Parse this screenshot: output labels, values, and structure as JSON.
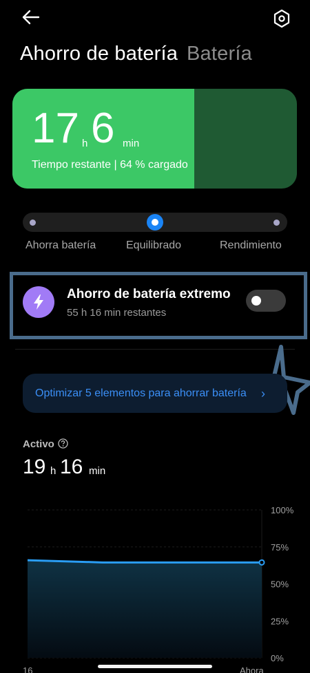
{
  "header": {
    "back_icon": "arrow-left-icon",
    "settings_icon": "gear-icon",
    "tabs": [
      {
        "label": "Ahorro de batería",
        "active": true
      },
      {
        "label": "Batería",
        "active": false
      }
    ]
  },
  "battery_card": {
    "hours": "17",
    "hours_unit": "h",
    "minutes": "6",
    "minutes_unit": "min",
    "info": "Tiempo restante | 64 % cargado",
    "charge_fraction": 0.64,
    "colors": {
      "fill": "#3cc866",
      "empty": "#1f5a33"
    }
  },
  "mode_selector": {
    "options": [
      {
        "label": "Ahorra batería",
        "selected": false
      },
      {
        "label": "Equilibrado",
        "selected": true
      },
      {
        "label": "Rendimiento",
        "selected": false
      }
    ],
    "accent": "#1a84f5"
  },
  "extreme_saver": {
    "icon": "lightning-bolt-icon",
    "title": "Ahorro de batería extremo",
    "subtitle": "55 h 16 min restantes",
    "enabled": false,
    "icon_color": "#a17bf6"
  },
  "annotation": {
    "highlight_color": "#4a6c8c",
    "arrow_icon": "cursor-arrow-icon"
  },
  "optimize_banner": {
    "text": "Optimizar 5 elementos para ahorrar batería",
    "chevron": "›",
    "color": "#3b8ff6"
  },
  "active": {
    "label": "Activo",
    "help_icon": "question-circle-icon",
    "hours": "19",
    "hours_unit": "h",
    "minutes": "16",
    "minutes_unit": "min"
  },
  "chart_data": {
    "type": "area",
    "x_labels": [
      "16",
      "Ahora"
    ],
    "y_labels": [
      "100%",
      "75%",
      "50%",
      "25%",
      "0%"
    ],
    "ylim": [
      0,
      100
    ],
    "x": [
      0,
      0.32,
      1
    ],
    "values": [
      66,
      64.5,
      64.5
    ],
    "line_color": "#2a9df4",
    "grid": true
  },
  "home_indicator": "home-bar"
}
